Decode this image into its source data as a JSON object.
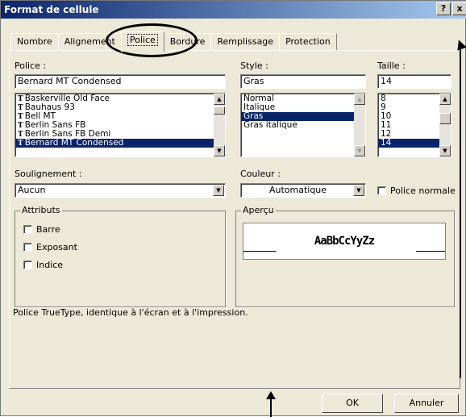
{
  "window": {
    "title": "Format de cellule",
    "help_btn": "?",
    "close_btn": "x"
  },
  "tabs": [
    {
      "label": "Nombre"
    },
    {
      "label": "Alignement"
    },
    {
      "label": "Police"
    },
    {
      "label": "Bordure"
    },
    {
      "label": "Remplissage"
    },
    {
      "label": "Protection"
    }
  ],
  "font": {
    "label": "Police :",
    "value": "Bernard MT Condensed",
    "items": [
      "Baskerville Old Face",
      "Bauhaus 93",
      "Bell MT",
      "Berlin Sans FB",
      "Berlin Sans FB Demi",
      "Bernard MT Condensed"
    ],
    "tt_glyph": "T"
  },
  "style": {
    "label": "Style :",
    "value": "Gras",
    "items": [
      "Normal",
      "Italique",
      "Gras",
      "Gras italique"
    ]
  },
  "size": {
    "label": "Taille :",
    "value": "14",
    "items": [
      "8",
      "9",
      "10",
      "11",
      "12",
      "14"
    ]
  },
  "underline": {
    "label": "Soulignement :",
    "value": "Aucun"
  },
  "color": {
    "label": "Couleur :",
    "value": "Automatique",
    "normal_font_label": "Police normale"
  },
  "attributes": {
    "title": "Attributs",
    "strike": "Barre",
    "superscript": "Exposant",
    "subscript": "Indice"
  },
  "preview": {
    "title": "Aperçu",
    "sample": "AaBbCcYyZz"
  },
  "info_text": "Police TrueType, identique à l'écran et à l'impression.",
  "buttons": {
    "ok": "OK",
    "cancel": "Annuler"
  },
  "colors": {
    "titlebar": "#0a246a",
    "selection": "#0a246a",
    "dialog_bg": "#ece9d8"
  }
}
